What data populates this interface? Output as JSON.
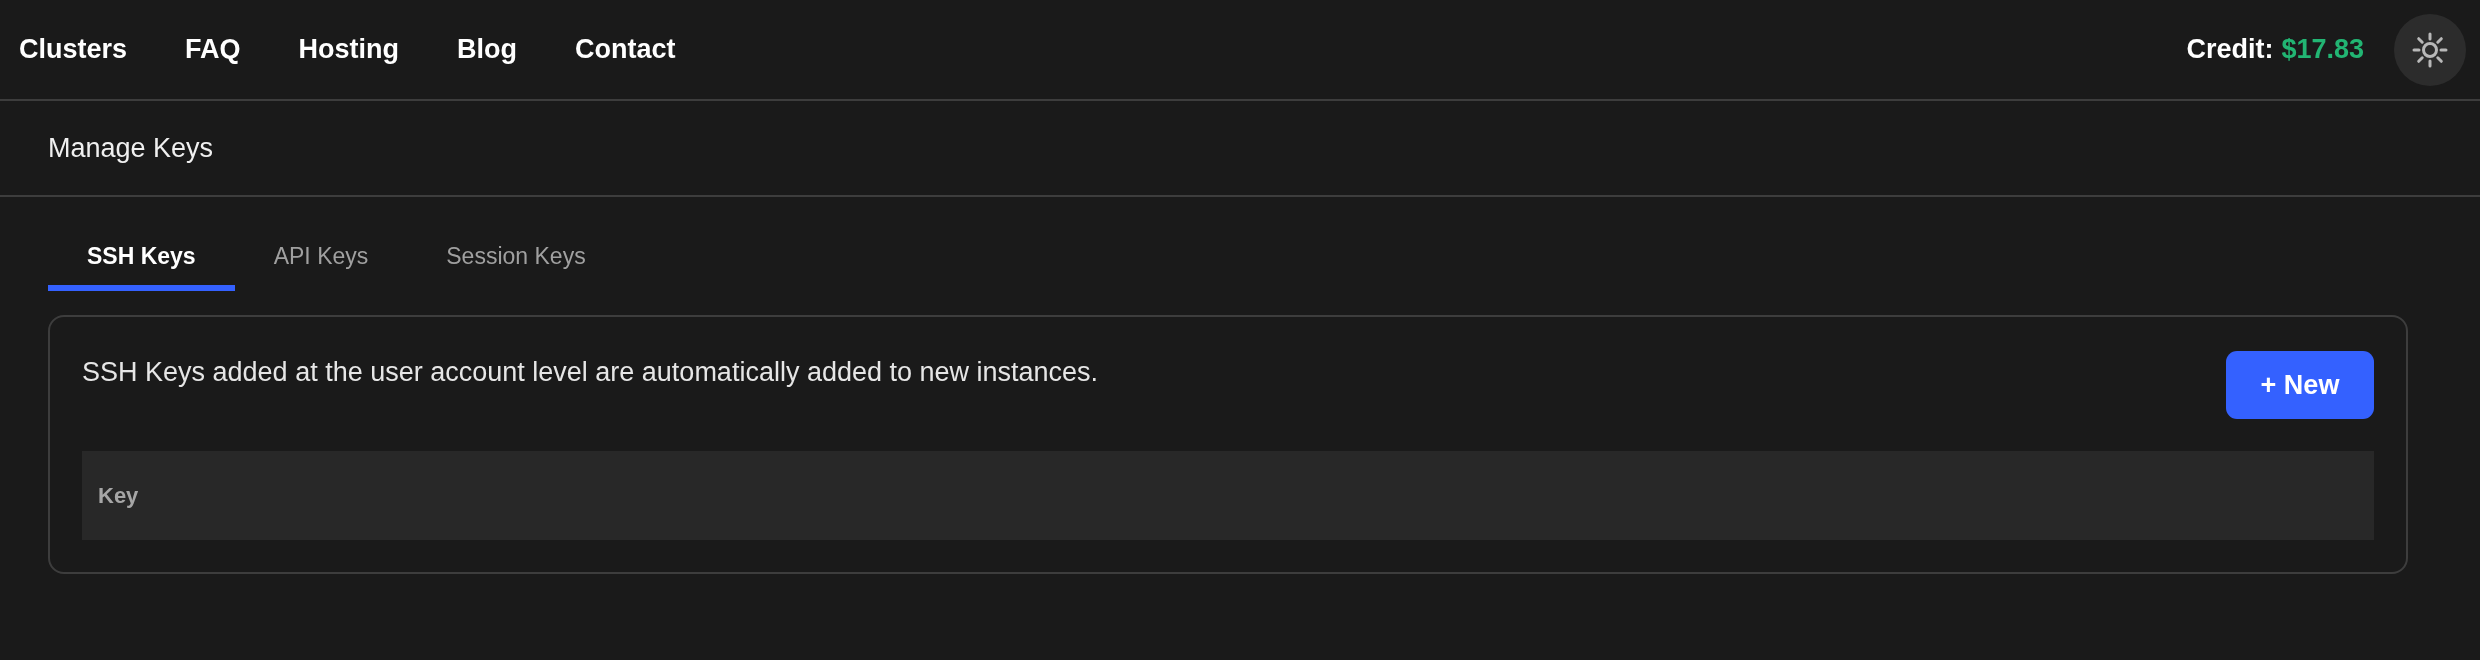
{
  "nav": {
    "links": [
      "Clusters",
      "FAQ",
      "Hosting",
      "Blog",
      "Contact"
    ],
    "credit": {
      "label": "Credit:",
      "amount": "$17.83"
    }
  },
  "header": {
    "title": "Manage Keys"
  },
  "tabs": [
    {
      "label": "SSH Keys",
      "selected": true
    },
    {
      "label": "API Keys",
      "selected": false
    },
    {
      "label": "Session Keys",
      "selected": false
    }
  ],
  "panel": {
    "description": "SSH Keys added at the user account level are automatically added to new instances.",
    "new_button": "+ New",
    "table": {
      "columns": [
        "Key"
      ]
    }
  }
}
